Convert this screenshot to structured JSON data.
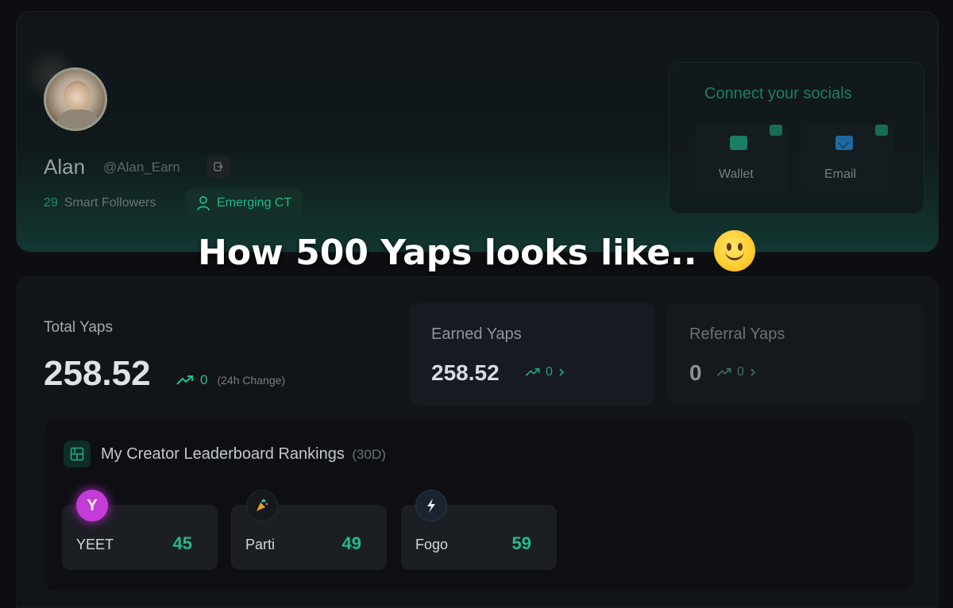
{
  "profile": {
    "name": "Alan",
    "handle": "@Alan_Earn",
    "smart_followers_count": "29",
    "smart_followers_label": "Smart Followers",
    "tier": "Emerging CT"
  },
  "socials": {
    "title": "Connect your socials",
    "buttons": [
      {
        "label": "Wallet",
        "icon": "wallet-icon"
      },
      {
        "label": "Email",
        "icon": "email-icon"
      }
    ]
  },
  "headline": "How 500 Yaps looks like..",
  "total_yaps": {
    "label": "Total Yaps",
    "value": "258.52",
    "change": "0",
    "change_label": "(24h Change)"
  },
  "earned_yaps": {
    "label": "Earned Yaps",
    "value": "258.52",
    "change": "0"
  },
  "referral_yaps": {
    "label": "Referral Yaps",
    "value": "0",
    "change": "0"
  },
  "leaderboard": {
    "title": "My Creator Leaderboard Rankings",
    "period": "(30D)",
    "items": [
      {
        "name": "YEET",
        "score": "45",
        "logo": "Y",
        "color": "#c43bd6"
      },
      {
        "name": "Parti",
        "score": "49",
        "logo": "confetti-icon",
        "color": "#15181c"
      },
      {
        "name": "Fogo",
        "score": "59",
        "logo": "bolt-icon",
        "color": "#1a2430"
      }
    ]
  },
  "colors": {
    "accent": "#24c190",
    "background": "#0c0e11"
  }
}
